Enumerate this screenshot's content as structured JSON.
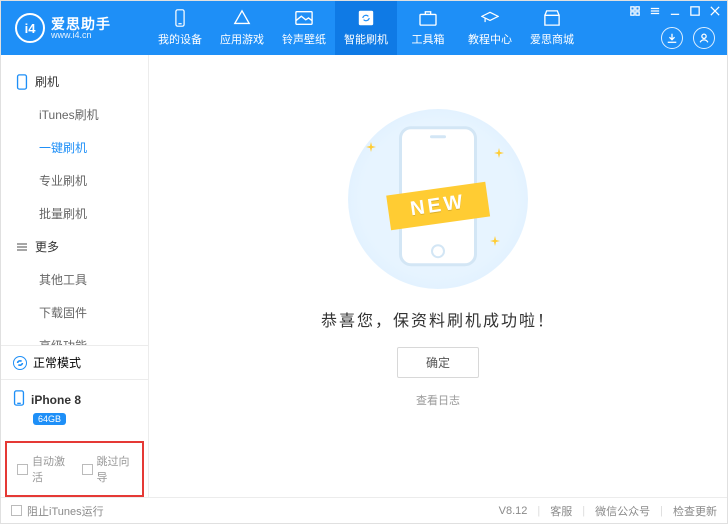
{
  "app": {
    "name_cn": "爱思助手",
    "site": "www.i4.cn"
  },
  "nav": {
    "items": [
      {
        "label": "我的设备"
      },
      {
        "label": "应用游戏"
      },
      {
        "label": "铃声壁纸"
      },
      {
        "label": "智能刷机"
      },
      {
        "label": "工具箱"
      },
      {
        "label": "教程中心"
      },
      {
        "label": "爱思商城"
      }
    ],
    "active_index": 3
  },
  "sidebar": {
    "sections": [
      {
        "title": "刷机",
        "items": [
          {
            "label": "iTunes刷机"
          },
          {
            "label": "一键刷机"
          },
          {
            "label": "专业刷机"
          },
          {
            "label": "批量刷机"
          }
        ],
        "selected_index": 1
      },
      {
        "title": "更多",
        "items": [
          {
            "label": "其他工具"
          },
          {
            "label": "下载固件"
          },
          {
            "label": "高级功能"
          }
        ]
      }
    ]
  },
  "status": {
    "mode": "正常模式",
    "device_name": "iPhone 8",
    "storage_badge": "64GB"
  },
  "bottom_options": {
    "auto_activate": "自动激活",
    "skip_setup": "跳过向导"
  },
  "main": {
    "ribbon": "NEW",
    "headline": "恭喜您，保资料刷机成功啦！",
    "ok_button": "确定",
    "view_log": "查看日志"
  },
  "footer": {
    "block_itunes": "阻止iTunes运行",
    "version": "V8.12",
    "links": [
      "客服",
      "微信公众号",
      "检查更新"
    ]
  }
}
